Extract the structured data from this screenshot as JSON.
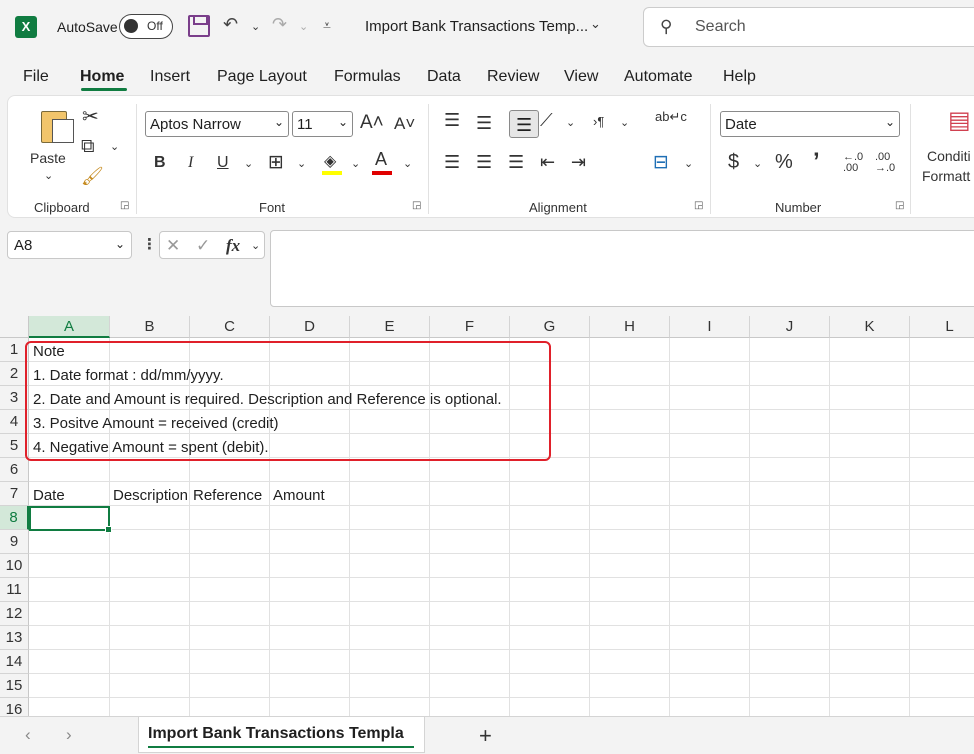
{
  "titlebar": {
    "app_icon": "X",
    "autosave_label": "AutoSave",
    "autosave_state": "Off",
    "doc_title": "Import Bank Transactions Temp...",
    "search_placeholder": "Search"
  },
  "menu": {
    "tabs": [
      "File",
      "Home",
      "Insert",
      "Page Layout",
      "Formulas",
      "Data",
      "Review",
      "View",
      "Automate",
      "Help"
    ],
    "active": "Home"
  },
  "ribbon": {
    "clipboard": {
      "paste_label": "Paste",
      "group_label": "Clipboard"
    },
    "font": {
      "font_name": "Aptos Narrow",
      "font_size": "11",
      "group_label": "Font",
      "bold": "B",
      "italic": "I",
      "underline": "U",
      "grow": "A˄",
      "shrink": "A˅",
      "font_color": "A",
      "highlight_color": "#ffff00",
      "font_color_value": "#e00000"
    },
    "alignment": {
      "group_label": "Alignment",
      "wrap_label": "ab↵c"
    },
    "number": {
      "format": "Date",
      "group_label": "Number",
      "currency": "$",
      "percent": "%",
      "comma": "’",
      "inc_decimal": "←.0\n.00",
      "dec_decimal": ".00\n→.0"
    },
    "styles": {
      "conditional_label_1": "Conditi",
      "conditional_label_2": "Formatt"
    }
  },
  "formula_bar": {
    "name_box": "A8",
    "cancel": "✕",
    "enter": "✓",
    "fx": "fx",
    "content": ""
  },
  "sheet": {
    "columns": [
      "A",
      "B",
      "C",
      "D",
      "E",
      "F",
      "G",
      "H",
      "I",
      "J",
      "K",
      "L"
    ],
    "rows": [
      "1",
      "2",
      "3",
      "4",
      "5",
      "6",
      "7",
      "8",
      "9",
      "10",
      "11",
      "12",
      "13",
      "14",
      "15",
      "16"
    ],
    "selected_cell": "A8",
    "cells": {
      "A1": "Note",
      "A2": "1. Date format : dd/mm/yyyy.",
      "A3": "2. Date and Amount is required. Description and Reference is optional.",
      "A4": "3. Positve Amount = received (credit)",
      "A5": "4. Negative Amount = spent (debit).",
      "A7": "Date",
      "B7": "Description",
      "C7": "Reference",
      "D7": "Amount"
    }
  },
  "sheet_tabs": {
    "active_tab": "Import Bank Transactions Templa",
    "add_label": "+"
  }
}
